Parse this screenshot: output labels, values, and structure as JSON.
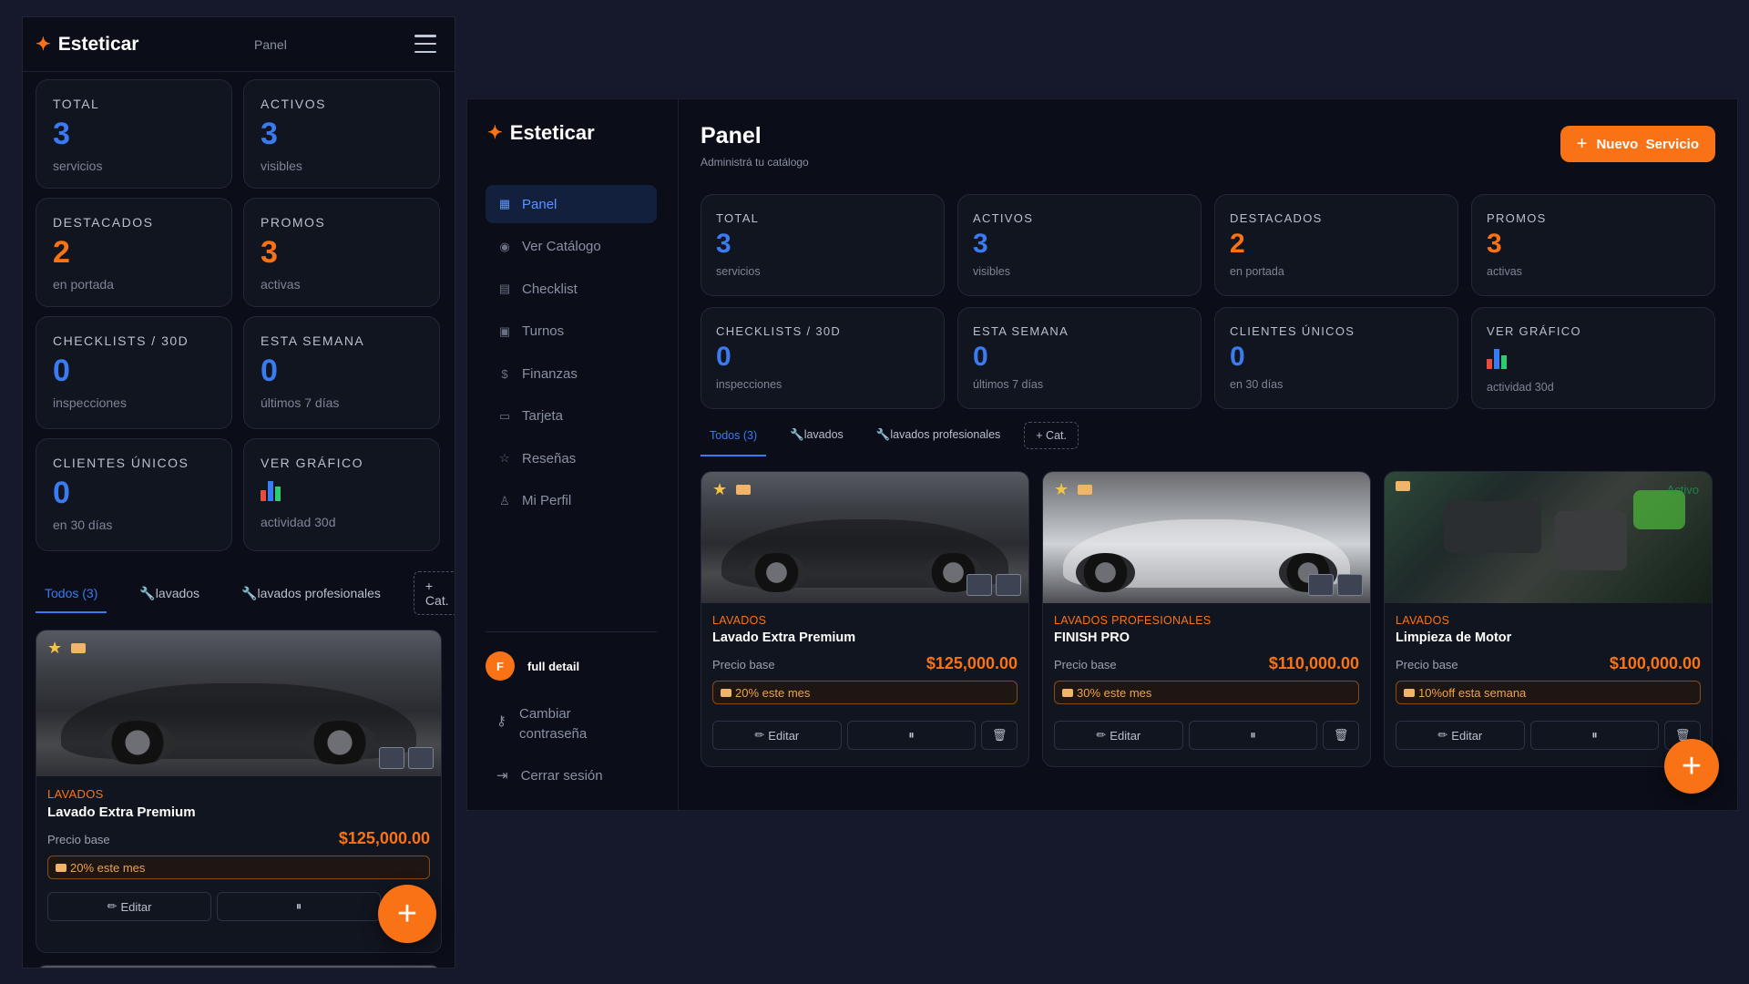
{
  "brand": "Esteticar",
  "colors": {
    "accent": "#f97316",
    "blue": "#3b7bf2",
    "background": "#0b0e18"
  },
  "mobile": {
    "header_tab": "Panel",
    "stats": [
      {
        "label": "TOTAL",
        "value": "3",
        "sub": "servicios",
        "color": "blue"
      },
      {
        "label": "ACTIVOS",
        "value": "3",
        "sub": "visibles",
        "color": "blue"
      },
      {
        "label": "DESTACADOS",
        "value": "2",
        "sub": "en portada",
        "color": "orange"
      },
      {
        "label": "PROMOS",
        "value": "3",
        "sub": "activas",
        "color": "orange"
      },
      {
        "label": "CHECKLISTS / 30D",
        "value": "0",
        "sub": "inspecciones",
        "color": "blue"
      },
      {
        "label": "ESTA SEMANA",
        "value": "0",
        "sub": "últimos 7 días",
        "color": "blue"
      },
      {
        "label": "CLIENTES ÚNICOS",
        "value": "0",
        "sub": "en 30 días",
        "color": "blue"
      },
      {
        "label": "VER GRÁFICO",
        "icon": "bar-chart-icon",
        "sub": "actividad 30d"
      }
    ],
    "tabs": [
      "Todos (3)",
      "lavados",
      "lavados profesionales"
    ],
    "add_category": "+ Cat.",
    "card": {
      "category": "LAVADOS",
      "name": "Lavado Extra Premium",
      "price_label": "Precio base",
      "price": "$125,000.00",
      "promo": "20% este mes",
      "edit_label": "Editar",
      "pause_label": "⏸"
    }
  },
  "desktop": {
    "nav": [
      {
        "label": "Panel",
        "icon": "grid-icon",
        "active": true
      },
      {
        "label": "Ver Catálogo",
        "icon": "eye-icon"
      },
      {
        "label": "Checklist",
        "icon": "clipboard-icon"
      },
      {
        "label": "Turnos",
        "icon": "calendar-icon"
      },
      {
        "label": "Finanzas",
        "icon": "dollar-icon"
      },
      {
        "label": "Tarjeta",
        "icon": "card-icon"
      },
      {
        "label": "Reseñas",
        "icon": "star-icon"
      },
      {
        "label": "Mi Perfil",
        "icon": "user-icon"
      }
    ],
    "user": {
      "initial": "F",
      "name": "full detail"
    },
    "change_password": "Cambiar contraseña",
    "logout": "Cerrar sesión",
    "title": "Panel",
    "subtitle": "Administrá tu catálogo",
    "new_button": "Nuevo  Servicio",
    "stats": [
      {
        "label": "TOTAL",
        "value": "3",
        "sub": "servicios",
        "color": "blue"
      },
      {
        "label": "ACTIVOS",
        "value": "3",
        "sub": "visibles",
        "color": "blue"
      },
      {
        "label": "DESTACADOS",
        "value": "2",
        "sub": "en portada",
        "color": "orange"
      },
      {
        "label": "PROMOS",
        "value": "3",
        "sub": "activas",
        "color": "orange"
      },
      {
        "label": "CHECKLISTS / 30D",
        "value": "0",
        "sub": "inspecciones",
        "color": "blue"
      },
      {
        "label": "ESTA SEMANA",
        "value": "0",
        "sub": "últimos 7 días",
        "color": "blue"
      },
      {
        "label": "CLIENTES ÚNICOS",
        "value": "0",
        "sub": "en 30 días",
        "color": "blue"
      },
      {
        "label": "VER GRÁFICO",
        "icon": "bar-chart-icon",
        "sub": "actividad 30d"
      }
    ],
    "tabs": [
      "Todos (3)",
      "lavados",
      "lavados profesionales"
    ],
    "add_category": "+ Cat.",
    "cards": [
      {
        "category": "LAVADOS",
        "name": "Lavado Extra Premium",
        "price_label": "Precio base",
        "price": "$125,000.00",
        "promo": "20% este mes",
        "edit_label": "Editar",
        "pause_label": "⏸",
        "image": "dark-sports-car"
      },
      {
        "category": "LAVADOS PROFESIONALES",
        "name": "FINISH PRO",
        "price_label": "Precio base",
        "price": "$110,000.00",
        "promo": "30% este mes",
        "edit_label": "Editar",
        "pause_label": "⏸",
        "image": "silver-sedan"
      },
      {
        "category": "LAVADOS",
        "name": "Limpieza de Motor",
        "price_label": "Precio base",
        "price": "$100,000.00",
        "promo": "10%off esta semana",
        "edit_label": "Editar",
        "pause_label": "⏸",
        "image": "engine-bay",
        "active_badge": "Activo"
      }
    ]
  }
}
